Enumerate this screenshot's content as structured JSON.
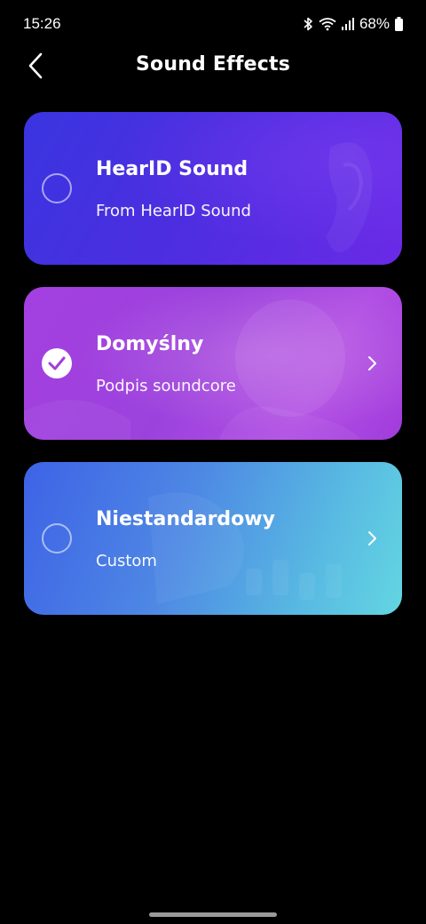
{
  "status_bar": {
    "time": "15:26",
    "battery_percent": "68%",
    "icons": [
      "bluetooth-icon",
      "wifi-icon",
      "signal-icon",
      "battery-icon"
    ]
  },
  "header": {
    "title": "Sound Effects",
    "back_icon": "chevron-left-icon"
  },
  "cards": [
    {
      "title": "HearID Sound",
      "subtitle": "From HearID Sound",
      "selected": false,
      "has_chevron": false
    },
    {
      "title": "Domyślny",
      "subtitle": "Podpis soundcore",
      "selected": true,
      "has_chevron": true
    },
    {
      "title": "Niestandardowy",
      "subtitle": "Custom",
      "selected": false,
      "has_chevron": true
    }
  ],
  "colors": {
    "background": "#000000",
    "card_hearid": "#4b2ee0",
    "card_default": "#a43fe0",
    "card_custom": "#58b8e2"
  }
}
